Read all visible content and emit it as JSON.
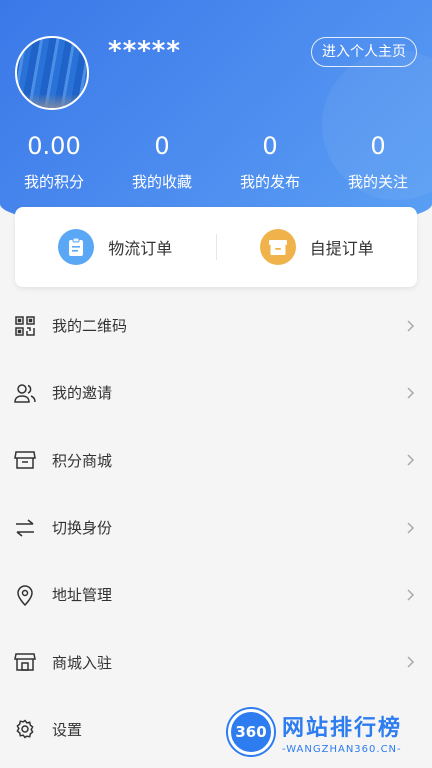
{
  "profile": {
    "username": "*****",
    "homepage_button": "进入个人主页"
  },
  "stats": [
    {
      "value": "0.00",
      "label": "我的积分"
    },
    {
      "value": "0",
      "label": "我的收藏"
    },
    {
      "value": "0",
      "label": "我的发布"
    },
    {
      "value": "0",
      "label": "我的关注"
    }
  ],
  "orders": [
    {
      "label": "物流订单",
      "icon": "clipboard-icon"
    },
    {
      "label": "自提订单",
      "icon": "box-icon"
    }
  ],
  "menu": [
    {
      "label": "我的二维码",
      "icon": "qr-code-icon"
    },
    {
      "label": "我的邀请",
      "icon": "users-icon"
    },
    {
      "label": "积分商城",
      "icon": "store-icon"
    },
    {
      "label": "切换身份",
      "icon": "swap-icon"
    },
    {
      "label": "地址管理",
      "icon": "location-pin-icon"
    },
    {
      "label": "商城入驻",
      "icon": "shop-icon"
    },
    {
      "label": "设置",
      "icon": "gear-icon"
    }
  ],
  "watermark": {
    "logo": "360",
    "title": "网站排行榜",
    "subtitle": "-WANGZHAN360.CN-"
  },
  "colors": {
    "header_blue": "#3a78e8",
    "order_blue": "#5aa7f5",
    "order_orange": "#f0b24a"
  }
}
